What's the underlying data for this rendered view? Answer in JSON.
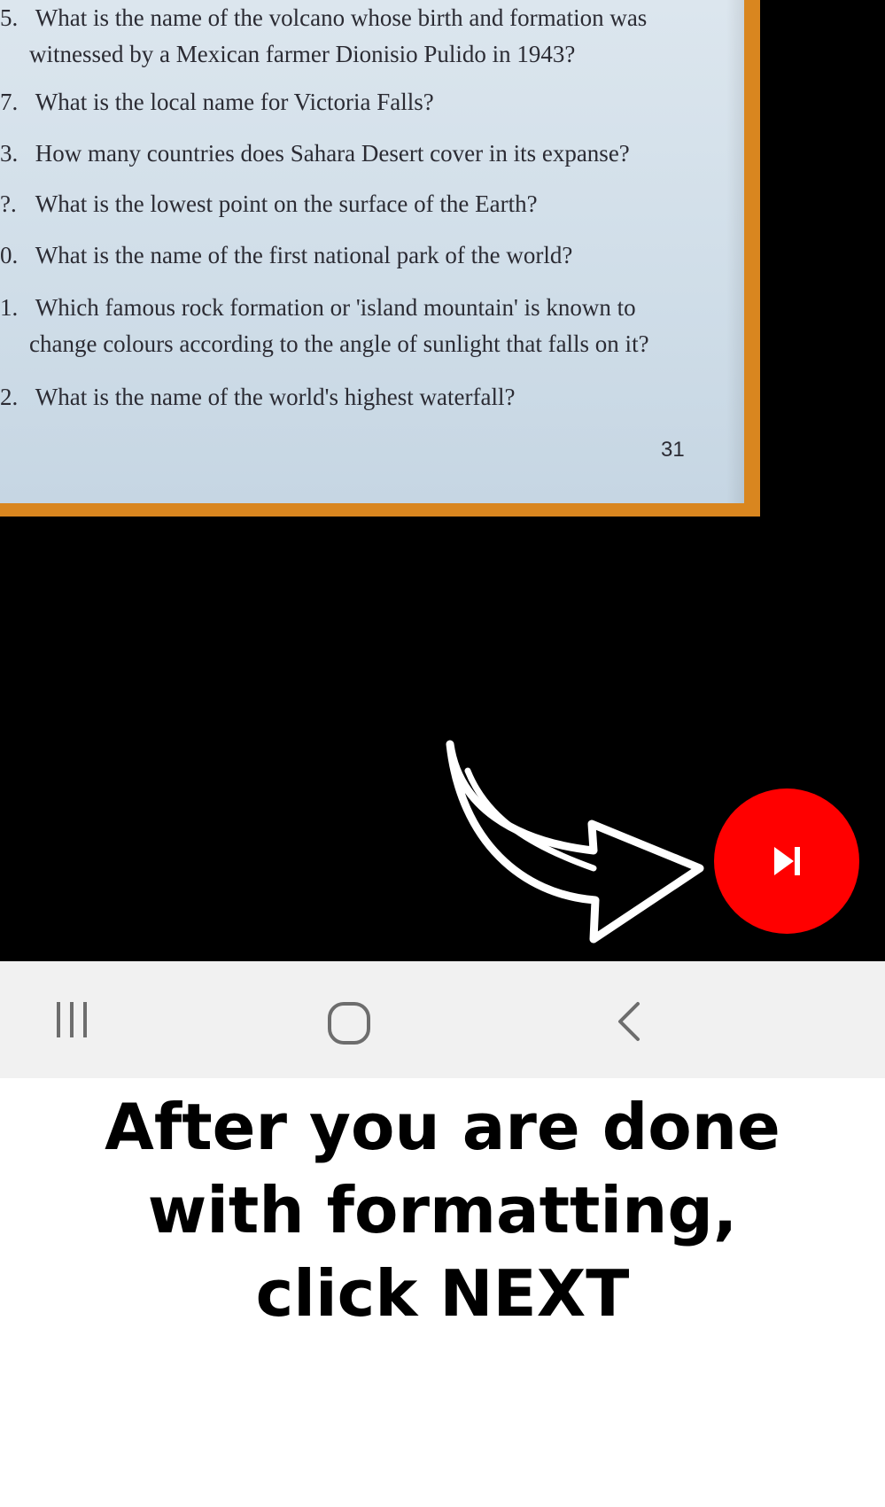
{
  "questions": [
    {
      "number": "5.",
      "lines": [
        "What is the name of the volcano whose birth and formation was",
        "witnessed by a Mexican farmer Dionisio Pulido in 1943?"
      ]
    },
    {
      "number": "7.",
      "lines": [
        "What is the local name for Victoria Falls?"
      ]
    },
    {
      "number": "3.",
      "lines": [
        "How many countries does Sahara Desert cover in its expanse?"
      ]
    },
    {
      "number": "?.",
      "lines": [
        "What is the lowest point on the surface of the Earth?"
      ]
    },
    {
      "number": "0.",
      "lines": [
        "What is the name of the first national park of the world?"
      ]
    },
    {
      "number": "1.",
      "lines": [
        "Which famous rock formation or 'island mountain' is known to",
        "change colours according to the angle of sunlight that falls on it?"
      ]
    },
    {
      "number": "2.",
      "lines": [
        "What is the name of the world's highest waterfall?"
      ]
    }
  ],
  "page_number": "31",
  "controls": {
    "next_button": {
      "icon": "skip-next-icon",
      "color": "#ff0000"
    },
    "arrow_icon": "curved-arrow-right-icon"
  },
  "navbar": {
    "recents_icon": "recent-apps-icon",
    "home_icon": "home-icon",
    "back_icon": "back-icon"
  },
  "caption": {
    "line1": "After you are done",
    "line2": "with formatting,",
    "line3": "click NEXT"
  }
}
